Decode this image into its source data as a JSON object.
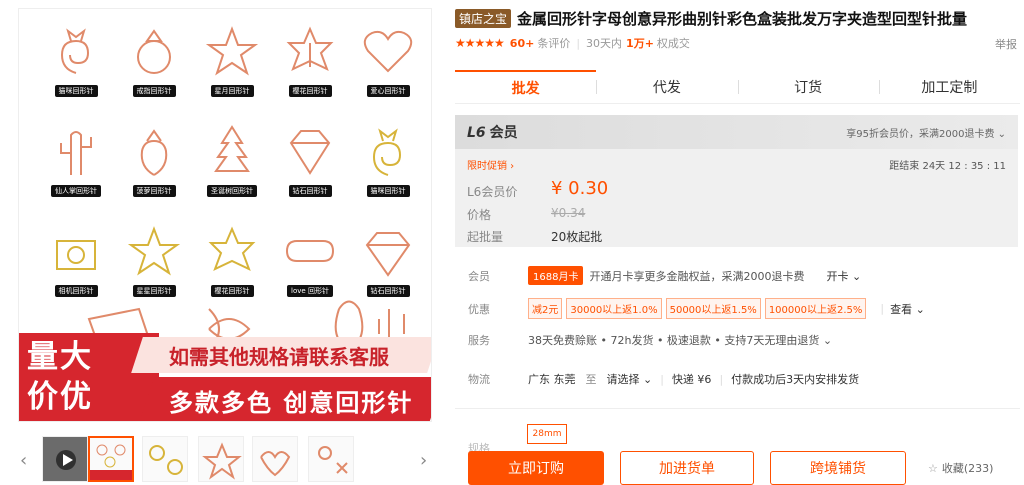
{
  "gallery": {
    "clips": [
      {
        "label": "猫咪回形针"
      },
      {
        "label": "戒指回形针"
      },
      {
        "label": "星月回形针"
      },
      {
        "label": "樱花回形针"
      },
      {
        "label": "爱心回形针"
      },
      {
        "label": "仙人掌回形针"
      },
      {
        "label": "菠萝回形针"
      },
      {
        "label": "圣诞树回形针"
      },
      {
        "label": "钻石回形针"
      },
      {
        "label": "猫咪回形针"
      },
      {
        "label": "相机回形针"
      },
      {
        "label": "星星回形针"
      },
      {
        "label": "樱花回形针"
      },
      {
        "label": "love 回形针"
      },
      {
        "label": "钻石回形针"
      }
    ],
    "banner_left": "量大\n价优",
    "banner_top": "如需其他规格请联系客服",
    "banner_bottom": "多款多色 创意回形针"
  },
  "thumbs": {
    "prev": "‹",
    "next": "›"
  },
  "product": {
    "shop_tag": "镇店之宝",
    "title": "金属回形针字母创意异形曲别针彩色盒装批发万字夹造型回型针批量",
    "stars": "★★★★★",
    "review_count": "60+",
    "review_label": "条评价",
    "sales_period": "30天内",
    "sales_count": "1万+",
    "sales_label": "权成交",
    "report": "举报"
  },
  "tabs": [
    "批发",
    "代发",
    "订货",
    "加工定制"
  ],
  "price": {
    "member_level": "L6",
    "member_word": "会员",
    "member_note": "享95折会员价，采满2000退卡费 ⌄",
    "promo": "限时促销 ›",
    "countdown": "距结束  24天 12 : 35 : 11",
    "member_price_label": "L6会员价",
    "member_price": "¥ 0.30",
    "price_label": "价格",
    "price": "¥0.34",
    "moq_label": "起批量",
    "moq": "20枚起批"
  },
  "info": {
    "member_label": "会员",
    "card_tag": "1688月卡",
    "card_text": "开通月卡享更多金融权益，采满2000退卡费",
    "card_action": "开卡 ⌄",
    "discount_label": "优惠",
    "coupons": [
      "减2元",
      "30000以上返1.0%",
      "50000以上返1.5%",
      "100000以上返2.5%"
    ],
    "discount_action": "查看 ⌄",
    "service_label": "服务",
    "service_text": "38天免费赊账 • 72h发货 • 极速退款 • 支持7天无理由退货 ⌄",
    "logistics_label": "物流",
    "ship_from": "广东 东莞",
    "ship_to_word": "至",
    "ship_to": "请选择 ⌄",
    "express": "快递  ¥6",
    "ship_note": "付款成功后3天内安排发货"
  },
  "spec": {
    "label": "规格",
    "chip": "28mm"
  },
  "actions": {
    "order": "立即订购",
    "cart": "加进货单",
    "crossborder": "跨境铺货",
    "fav": "收藏(233)"
  },
  "colors": {
    "accent": "#ff5000",
    "banner_red": "#d6262e",
    "rose_gold": "#e08a6a",
    "gold": "#d7b43a"
  }
}
